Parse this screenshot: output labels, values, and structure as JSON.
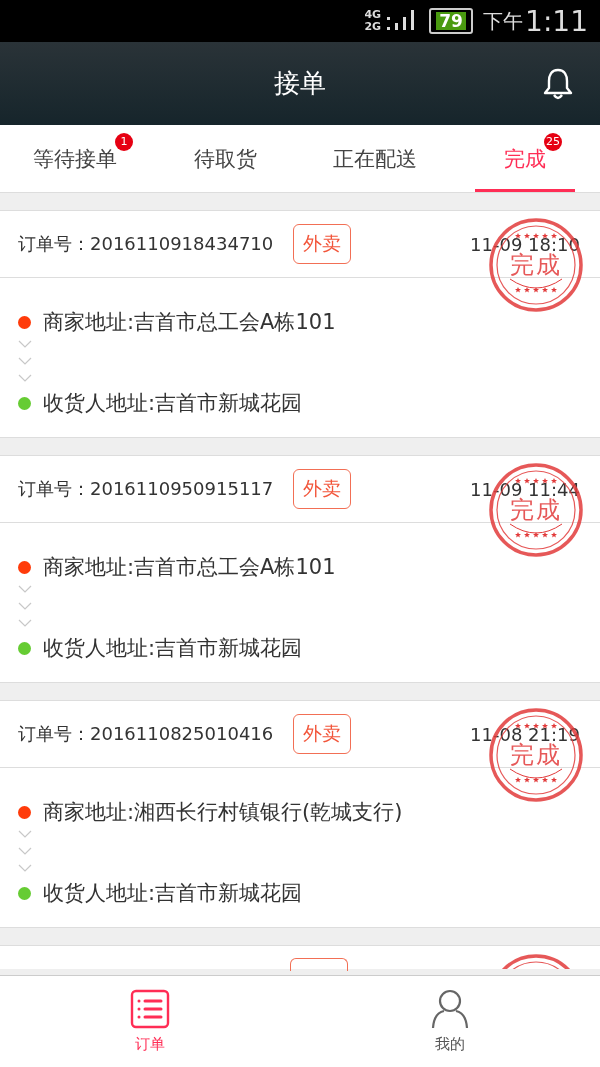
{
  "status_bar": {
    "network_top": "4G",
    "network_bottom": "2G",
    "battery": "79",
    "period": "下午",
    "time": "1:11"
  },
  "header": {
    "title": "接单"
  },
  "tabs": [
    {
      "label": "等待接单",
      "selected": false,
      "badge": "1"
    },
    {
      "label": "待取货",
      "selected": false
    },
    {
      "label": "正在配送",
      "selected": false
    },
    {
      "label": "完成",
      "selected": true,
      "badge": "25"
    }
  ],
  "orders": [
    {
      "number": "订单号：2016110918434710",
      "tag": "外卖",
      "time": "11-09 18:10",
      "stamp": "完成",
      "addresses": [
        {
          "text": "商家地址:吉首市总工会A栋101",
          "color": "#ff3b0a"
        },
        {
          "text": "收货人地址:吉首市新城花园",
          "color": "#66cc33"
        }
      ]
    },
    {
      "number": "订单号：2016110950915117",
      "tag": "外卖",
      "time": "11-09 11:44",
      "stamp": "完成",
      "addresses": [
        {
          "text": "商家地址:吉首市总工会A栋101",
          "color": "#ff3b0a"
        },
        {
          "text": "收货人地址:吉首市新城花园",
          "color": "#66cc33"
        }
      ]
    },
    {
      "number": "订单号：2016110825010416",
      "tag": "外卖",
      "time": "11-08 21:19",
      "stamp": "完成",
      "addresses": [
        {
          "text": "商家地址:湘西长行村镇银行(乾城支行)",
          "color": "#ff3b0a"
        },
        {
          "text": "收货人地址:吉首市新城花园",
          "color": "#66cc33"
        }
      ]
    }
  ],
  "bottom_nav": [
    {
      "label": "订单",
      "kind": "list",
      "selected": true
    },
    {
      "label": "我的",
      "kind": "person",
      "selected": false
    }
  ]
}
